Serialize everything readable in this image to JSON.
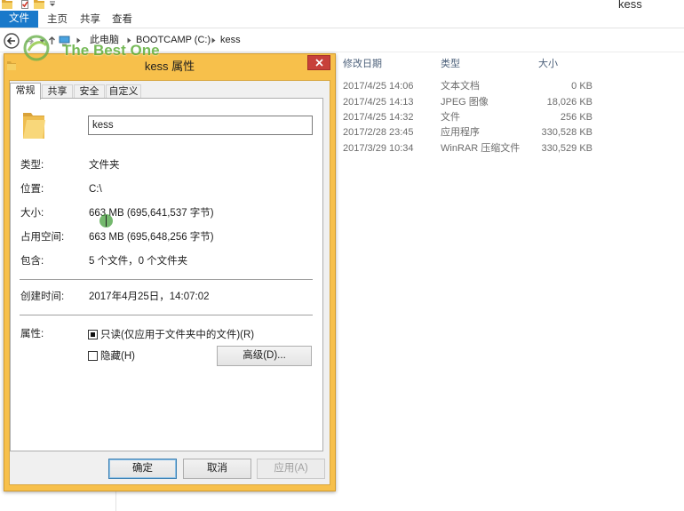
{
  "window": {
    "title": "kess"
  },
  "ribbon": {
    "tabs": {
      "file": "文件",
      "home": "主页",
      "share": "共享",
      "view": "查看"
    }
  },
  "address": {
    "crumbs": [
      "此电脑",
      "BOOTCAMP (C:)",
      "kess"
    ]
  },
  "watermark": {
    "text": "The Best One"
  },
  "file_list": {
    "headers": {
      "date": "修改日期",
      "type": "类型",
      "size": "大小"
    },
    "rows": [
      {
        "date": "2017/4/25 14:06",
        "type": "文本文档",
        "size": "0 KB"
      },
      {
        "date": "2017/4/25 14:13",
        "type": "JPEG 图像",
        "size": "18,026 KB"
      },
      {
        "date": "2017/4/25 14:32",
        "type": "文件",
        "size": "256 KB"
      },
      {
        "date": "2017/2/28 23:45",
        "type": "应用程序",
        "size": "330,528 KB"
      },
      {
        "date": "2017/3/29 10:34",
        "type": "WinRAR 压缩文件",
        "size": "330,529 KB"
      }
    ]
  },
  "dialog": {
    "title": "kess 属性",
    "tabs": [
      "常规",
      "共享",
      "安全",
      "自定义"
    ],
    "name_value": "kess",
    "rows": [
      {
        "label": "类型:",
        "value": "文件夹"
      },
      {
        "label": "位置:",
        "value": "C:\\"
      },
      {
        "label": "大小:",
        "value": "663 MB (695,641,537 字节)"
      },
      {
        "label": "占用空间:",
        "value": "663 MB (695,648,256 字节)"
      },
      {
        "label": "包含:",
        "value": "5 个文件，0 个文件夹"
      }
    ],
    "created": {
      "label": "创建时间:",
      "value": "2017年4月25日，14:07:02"
    },
    "attributes": {
      "label": "属性:",
      "readonly": {
        "label": "只读(仅应用于文件夹中的文件)(R)",
        "checked": true
      },
      "hidden": {
        "label": "隐藏(H)",
        "checked": false
      },
      "advanced_button": "高级(D)..."
    },
    "buttons": {
      "ok": "确定",
      "cancel": "取消",
      "apply": "应用(A)",
      "apply_enabled": false
    }
  },
  "icons": {
    "quick_access": [
      "folder-icon",
      "properties-icon",
      "new-folder-icon",
      "customize-toolbar-icon"
    ],
    "navigation": [
      "back-icon",
      "forward-icon",
      "recent-locations-icon",
      "up-icon",
      "pc-icon"
    ],
    "dialog": [
      "folder-icon",
      "close-icon"
    ]
  },
  "colors": {
    "accent": "#1979ca",
    "dialog_frame": "#f7c04b",
    "close_button": "#c7403a",
    "watermark": "#5faf3c"
  }
}
